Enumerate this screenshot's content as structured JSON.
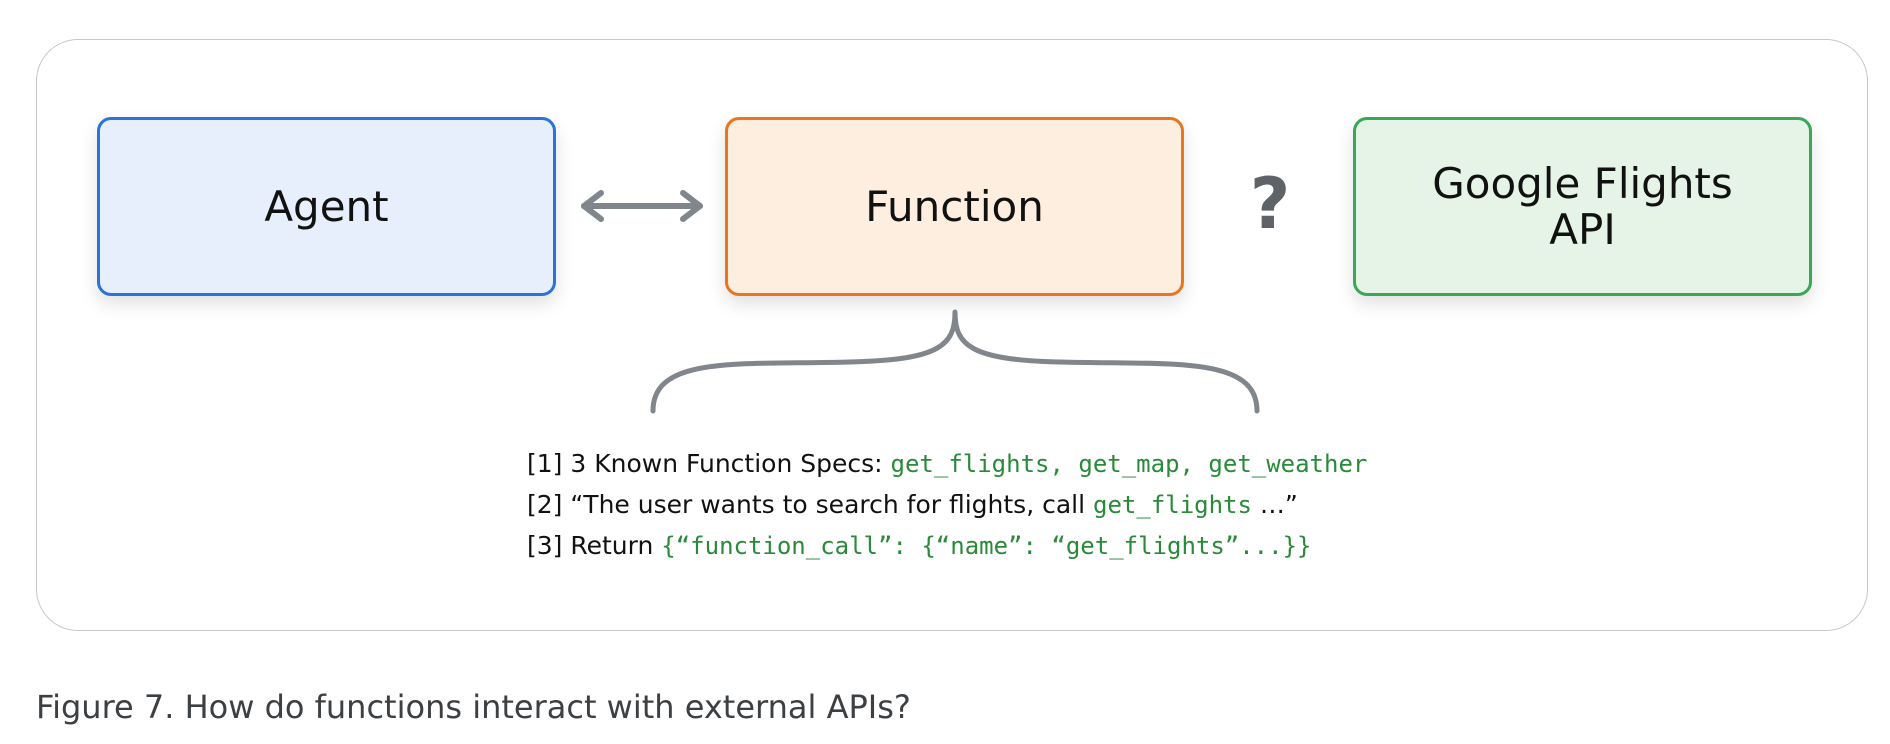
{
  "diagram": {
    "boxes": {
      "agent": {
        "label": "Agent",
        "fill": "#e8effc",
        "border": "#2a74d9"
      },
      "function": {
        "label": "Function",
        "fill": "#fdeee0",
        "border": "#e8761e"
      },
      "google_flights": {
        "label": "Google Flights\nAPI",
        "fill": "#e6f4e7",
        "border": "#3aa757"
      }
    },
    "question_mark": "?",
    "connector": "bidirectional-arrow",
    "brace": "curly-brace-under-function",
    "notes": [
      {
        "prefix": "[1] 3 Known Function Specs: ",
        "code": "get_flights, get_map, get_weather",
        "suffix": ""
      },
      {
        "prefix": "[2] “The user wants to search for flights, call ",
        "code": "get_flights",
        "suffix": " …”"
      },
      {
        "prefix": "[3] Return ",
        "code": "{“function_call”: {“name”: “get_flights”...}}",
        "suffix": ""
      }
    ],
    "code_color": "#2a8a3a"
  },
  "caption": "Figure 7. How do functions interact with external APIs?"
}
